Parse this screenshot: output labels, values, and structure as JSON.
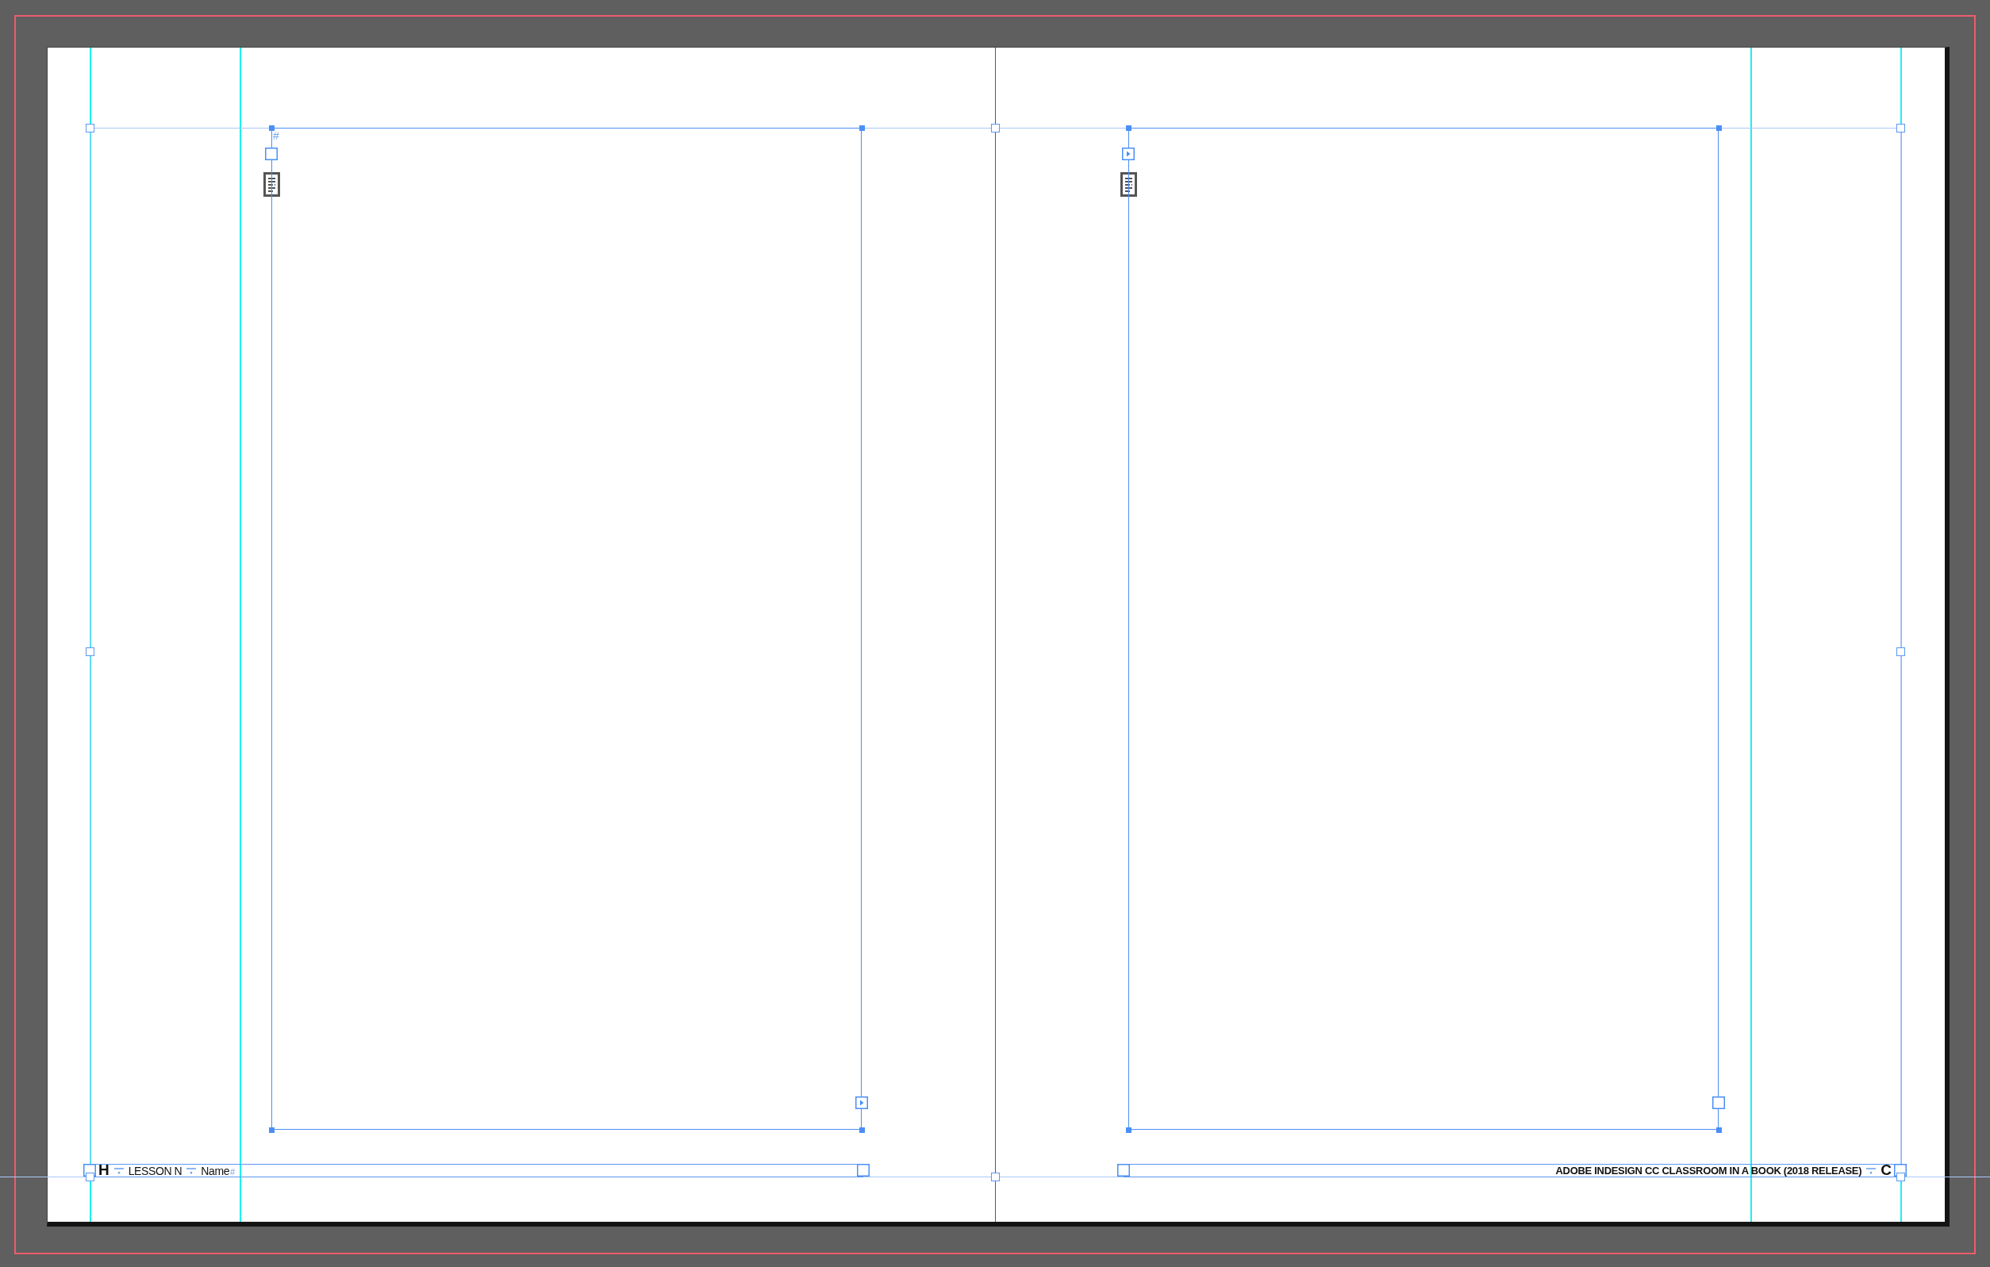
{
  "spread": {
    "pages": [
      {
        "text_frame": {
          "story_mark": "#",
          "in_port": {
            "threaded": false
          },
          "out_port": {
            "threaded": true
          }
        },
        "footer": {
          "in_port": {
            "threaded": false
          },
          "out_port": {
            "threaded": false
          },
          "runs": [
            {
              "kind": "chapter",
              "text": "H"
            },
            {
              "kind": "tab"
            },
            {
              "kind": "text",
              "text": "LESSON N",
              "bold": false
            },
            {
              "kind": "tab"
            },
            {
              "kind": "text",
              "text": "Name",
              "bold": false
            },
            {
              "kind": "mark",
              "text": "#"
            }
          ]
        }
      },
      {
        "text_frame": {
          "in_port": {
            "threaded": true
          },
          "out_port": {
            "threaded": false
          }
        },
        "footer": {
          "in_port": {
            "threaded": false
          },
          "out_port": {
            "threaded": false
          },
          "runs": [
            {
              "kind": "text",
              "text": "ADOBE INDESIGN CC CLASSROOM IN A BOOK (2018 RELEASE)",
              "bold": true
            },
            {
              "kind": "tab"
            },
            {
              "kind": "chapter",
              "text": "C"
            }
          ]
        }
      }
    ]
  }
}
